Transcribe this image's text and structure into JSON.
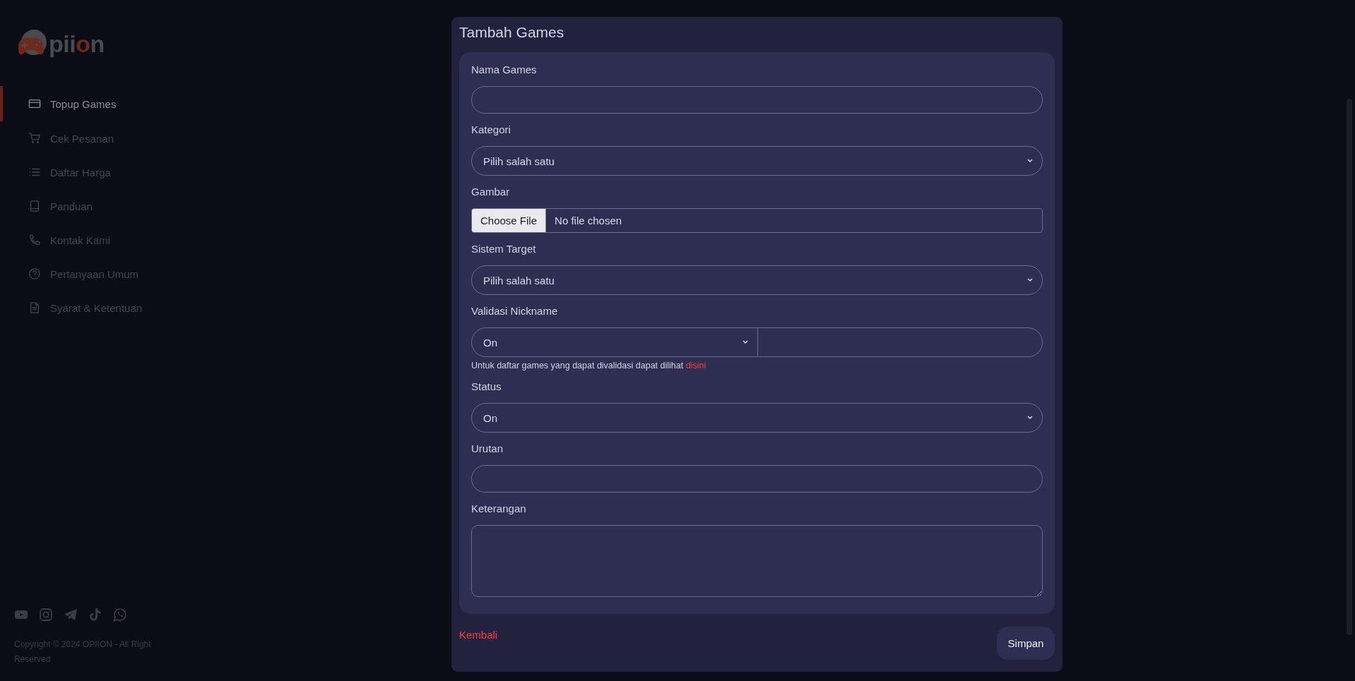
{
  "sidebar": {
    "logo_text": "piion",
    "items": [
      {
        "label": "Topup Games",
        "selected": true
      },
      {
        "label": "Cek Pesanan",
        "selected": false
      },
      {
        "label": "Daftar Harga",
        "selected": false
      },
      {
        "label": "Panduan",
        "selected": false
      },
      {
        "label": "Kontak Kami",
        "selected": false
      },
      {
        "label": "Pertanyaan Umum",
        "selected": false
      },
      {
        "label": "Syarat & Ketentuan",
        "selected": false
      }
    ],
    "copyright": "Copyright © 2024 OPIION - All Right Reserved"
  },
  "modal": {
    "title": "Tambah Games",
    "fields": [
      {
        "label": "Nama Games",
        "kind": "text"
      },
      {
        "label": "Kategori",
        "kind": "select",
        "value": "Pilih salah satu"
      },
      {
        "label": "Gambar",
        "kind": "file",
        "button": "Choose File",
        "value": "No file chosen"
      },
      {
        "label": "Sistem Target",
        "kind": "select",
        "value": "Pilih salah satu"
      },
      {
        "label": "Validasi Nickname",
        "kind": "select-input",
        "value": "On",
        "help": "Untuk daftar games yang dapat divalidasi dapat dilihat",
        "link": "disini"
      },
      {
        "label": "Status",
        "kind": "select",
        "value": "On"
      },
      {
        "label": "Urutan",
        "kind": "text"
      },
      {
        "label": "Keterangan",
        "kind": "textarea"
      }
    ],
    "back_link": "Kembali",
    "submit": "Simpan"
  }
}
